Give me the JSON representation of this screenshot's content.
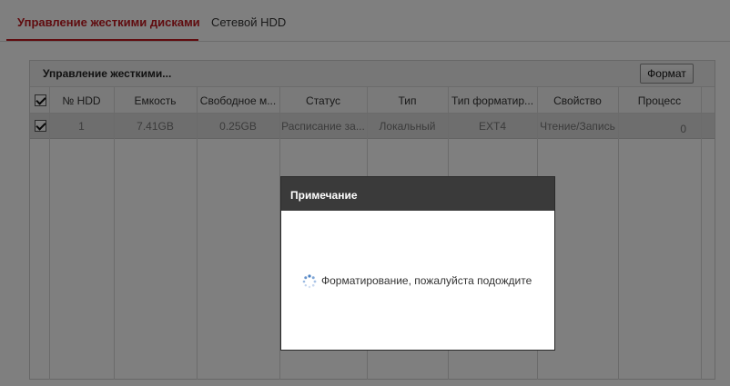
{
  "tabs": {
    "active": "Управление жесткими дисками",
    "inactive": "Сетевой HDD"
  },
  "panel": {
    "title": "Управление жесткими...",
    "format_button": "Формат"
  },
  "table": {
    "headers": [
      "№ HDD",
      "Емкость",
      "Свободное м...",
      "Статус",
      "Тип",
      "Тип форматир...",
      "Свойство",
      "Процесс"
    ],
    "rows": [
      {
        "checked": true,
        "cells": [
          "1",
          "7.41GB",
          "0.25GB",
          "Расписание за...",
          "Локальный",
          "EXT4",
          "Чтение/Запись",
          "0"
        ]
      }
    ]
  },
  "dialog": {
    "title": "Примечание",
    "message": "Форматирование, пожалуйста подождите"
  },
  "colors": {
    "accent": "#c0181f",
    "dialog_header": "#3a3a3a"
  }
}
